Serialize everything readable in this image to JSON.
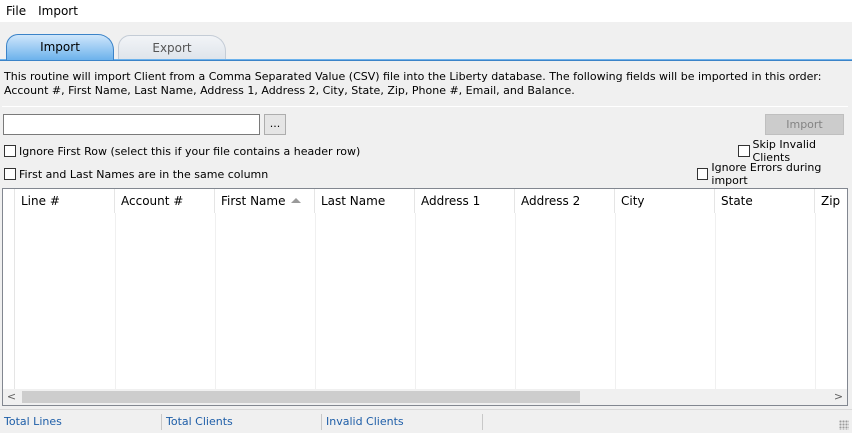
{
  "menu": {
    "items": [
      "File",
      "Import"
    ]
  },
  "tabs": [
    {
      "label": "Import",
      "active": true
    },
    {
      "label": "Export",
      "active": false
    }
  ],
  "description": "This routine will import Client from a Comma Separated Value (CSV) file into the Liberty database.  The following fields will be imported in this order: Account #, First Name, Last Name, Address 1, Address 2, City, State, Zip, Phone #, Email, and Balance.",
  "file_input": {
    "value": "",
    "placeholder": ""
  },
  "browse_label": "...",
  "import_button": {
    "label": "Import",
    "enabled": false
  },
  "checkboxes": {
    "ignore_first_row": {
      "label": "Ignore First Row (select this if your file contains a header row)",
      "checked": false
    },
    "same_column": {
      "label": "First and Last Names are in the same column",
      "checked": false
    },
    "skip_invalid": {
      "label": "Skip Invalid Clients",
      "checked": false
    },
    "ignore_errors": {
      "label": "Ignore Errors during import",
      "checked": false
    }
  },
  "grid": {
    "columns": [
      "Line #",
      "Account #",
      "First Name",
      "Last Name",
      "Address 1",
      "Address 2",
      "City",
      "State",
      "Zip"
    ],
    "sorted_column": "First Name",
    "rows": []
  },
  "scrollbar": {
    "left_arrow": "<",
    "right_arrow": ">"
  },
  "status": {
    "total_lines": "Total Lines",
    "total_clients": "Total Clients",
    "invalid_clients": "Invalid Clients"
  },
  "colors": {
    "active_tab": "#6cb2ec",
    "status_text": "#1e5ea8",
    "disabled_button": "#cccccc"
  }
}
